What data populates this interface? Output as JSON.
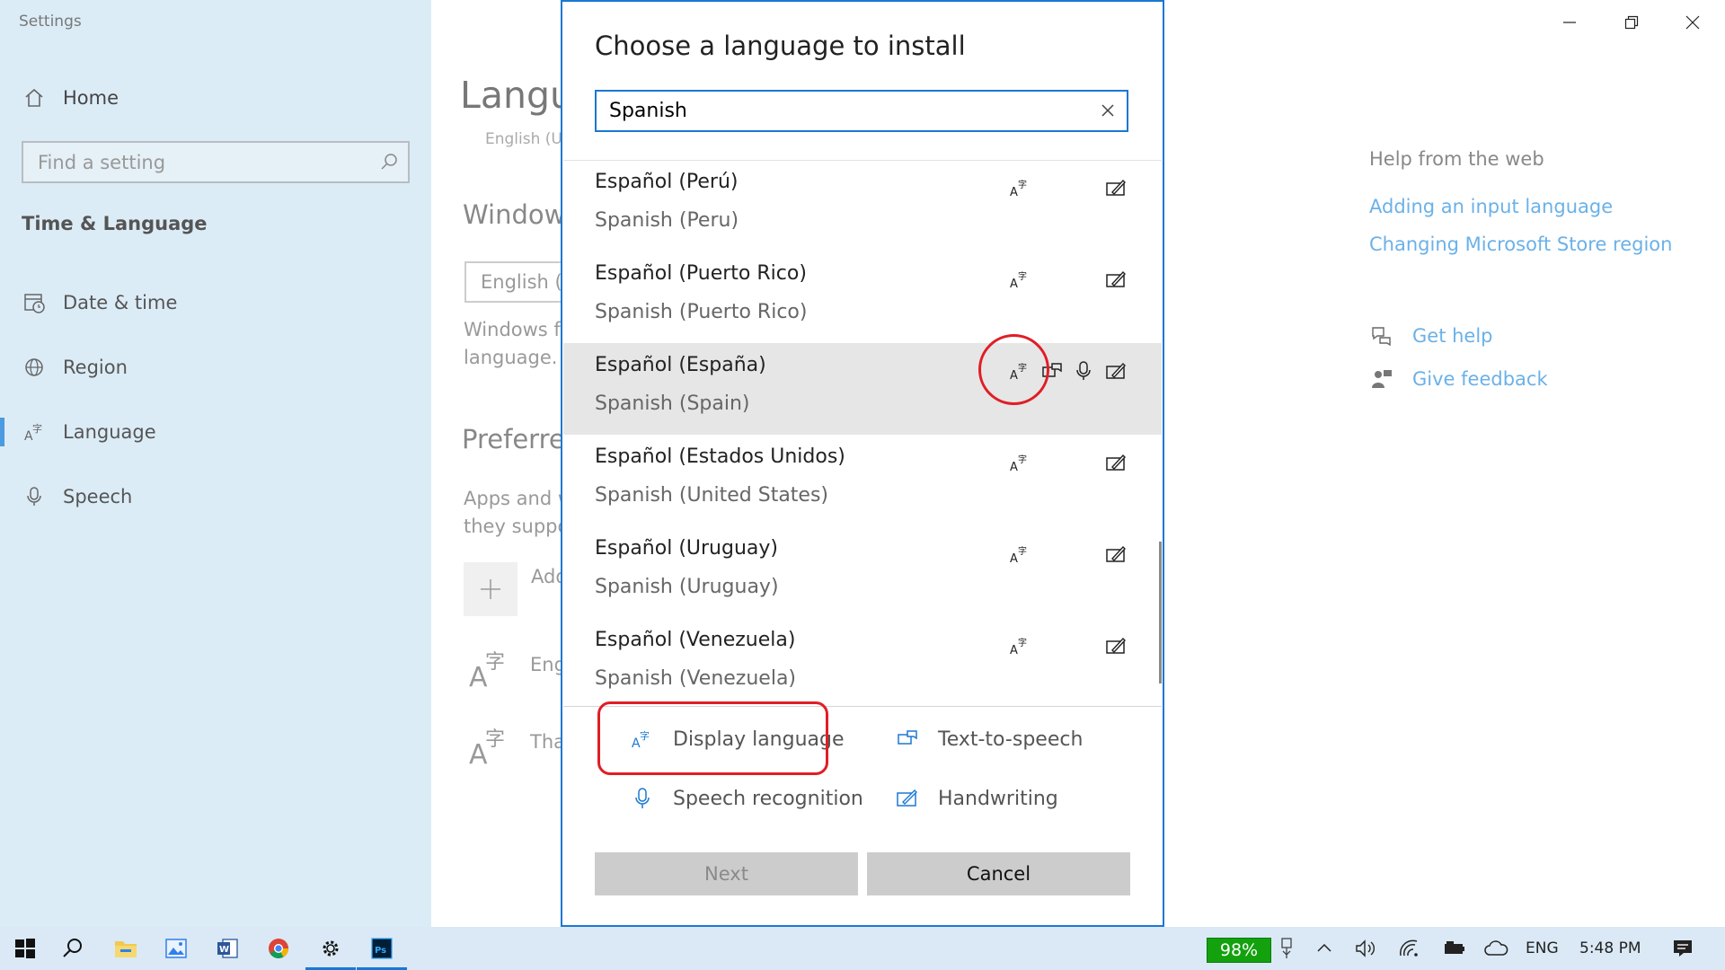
{
  "app": {
    "title": "Settings"
  },
  "sidebar": {
    "home": "Home",
    "search_placeholder": "Find a setting",
    "section": "Time & Language",
    "items": [
      {
        "label": "Date & time",
        "icon": "calendar-clock-icon"
      },
      {
        "label": "Region",
        "icon": "globe-icon"
      },
      {
        "label": "Language",
        "icon": "language-icon"
      },
      {
        "label": "Speech",
        "icon": "microphone-icon"
      }
    ]
  },
  "main": {
    "title": "Langu",
    "subtitle": "English (U",
    "windows_display_heading": "Window",
    "display_dropdown": "English (U",
    "windows_display_desc": "Windows fe language.",
    "preferred_heading": "Preferre",
    "preferred_desc": "Apps and w they suppo",
    "add_language": "Add",
    "preferred_languages": [
      "Eng",
      "Thai"
    ]
  },
  "help": {
    "heading": "Help from the web",
    "links": [
      "Adding an input language",
      "Changing Microsoft Store region"
    ],
    "get_help": "Get help",
    "give_feedback": "Give feedback"
  },
  "dialog": {
    "title": "Choose a language to install",
    "search_value": "Spanish",
    "languages": [
      {
        "native": "Español (Perú)",
        "english": "Spanish (Peru)",
        "features": [
          "display",
          "handwriting"
        ]
      },
      {
        "native": "Español (Puerto Rico)",
        "english": "Spanish (Puerto Rico)",
        "features": [
          "display",
          "handwriting"
        ]
      },
      {
        "native": "Español (España)",
        "english": "Spanish (Spain)",
        "features": [
          "display",
          "tts",
          "speech",
          "handwriting"
        ],
        "selected": true
      },
      {
        "native": "Español (Estados Unidos)",
        "english": "Spanish (United States)",
        "features": [
          "display",
          "handwriting"
        ]
      },
      {
        "native": "Español (Uruguay)",
        "english": "Spanish (Uruguay)",
        "features": [
          "display",
          "handwriting"
        ]
      },
      {
        "native": "Español (Venezuela)",
        "english": "Spanish (Venezuela)",
        "features": [
          "display",
          "handwriting"
        ]
      }
    ],
    "legend": {
      "display": "Display language",
      "tts": "Text-to-speech",
      "speech": "Speech recognition",
      "handwriting": "Handwriting"
    },
    "next_label": "Next",
    "cancel_label": "Cancel"
  },
  "taskbar": {
    "battery_percent": "98%",
    "language": "ENG",
    "time": "5:48 PM"
  },
  "colors": {
    "accent": "#1a78d2",
    "sidebar_bg": "#dcecf7",
    "link": "#6bb1e8",
    "annotation": "#e01e26",
    "battery": "#13a10e"
  }
}
